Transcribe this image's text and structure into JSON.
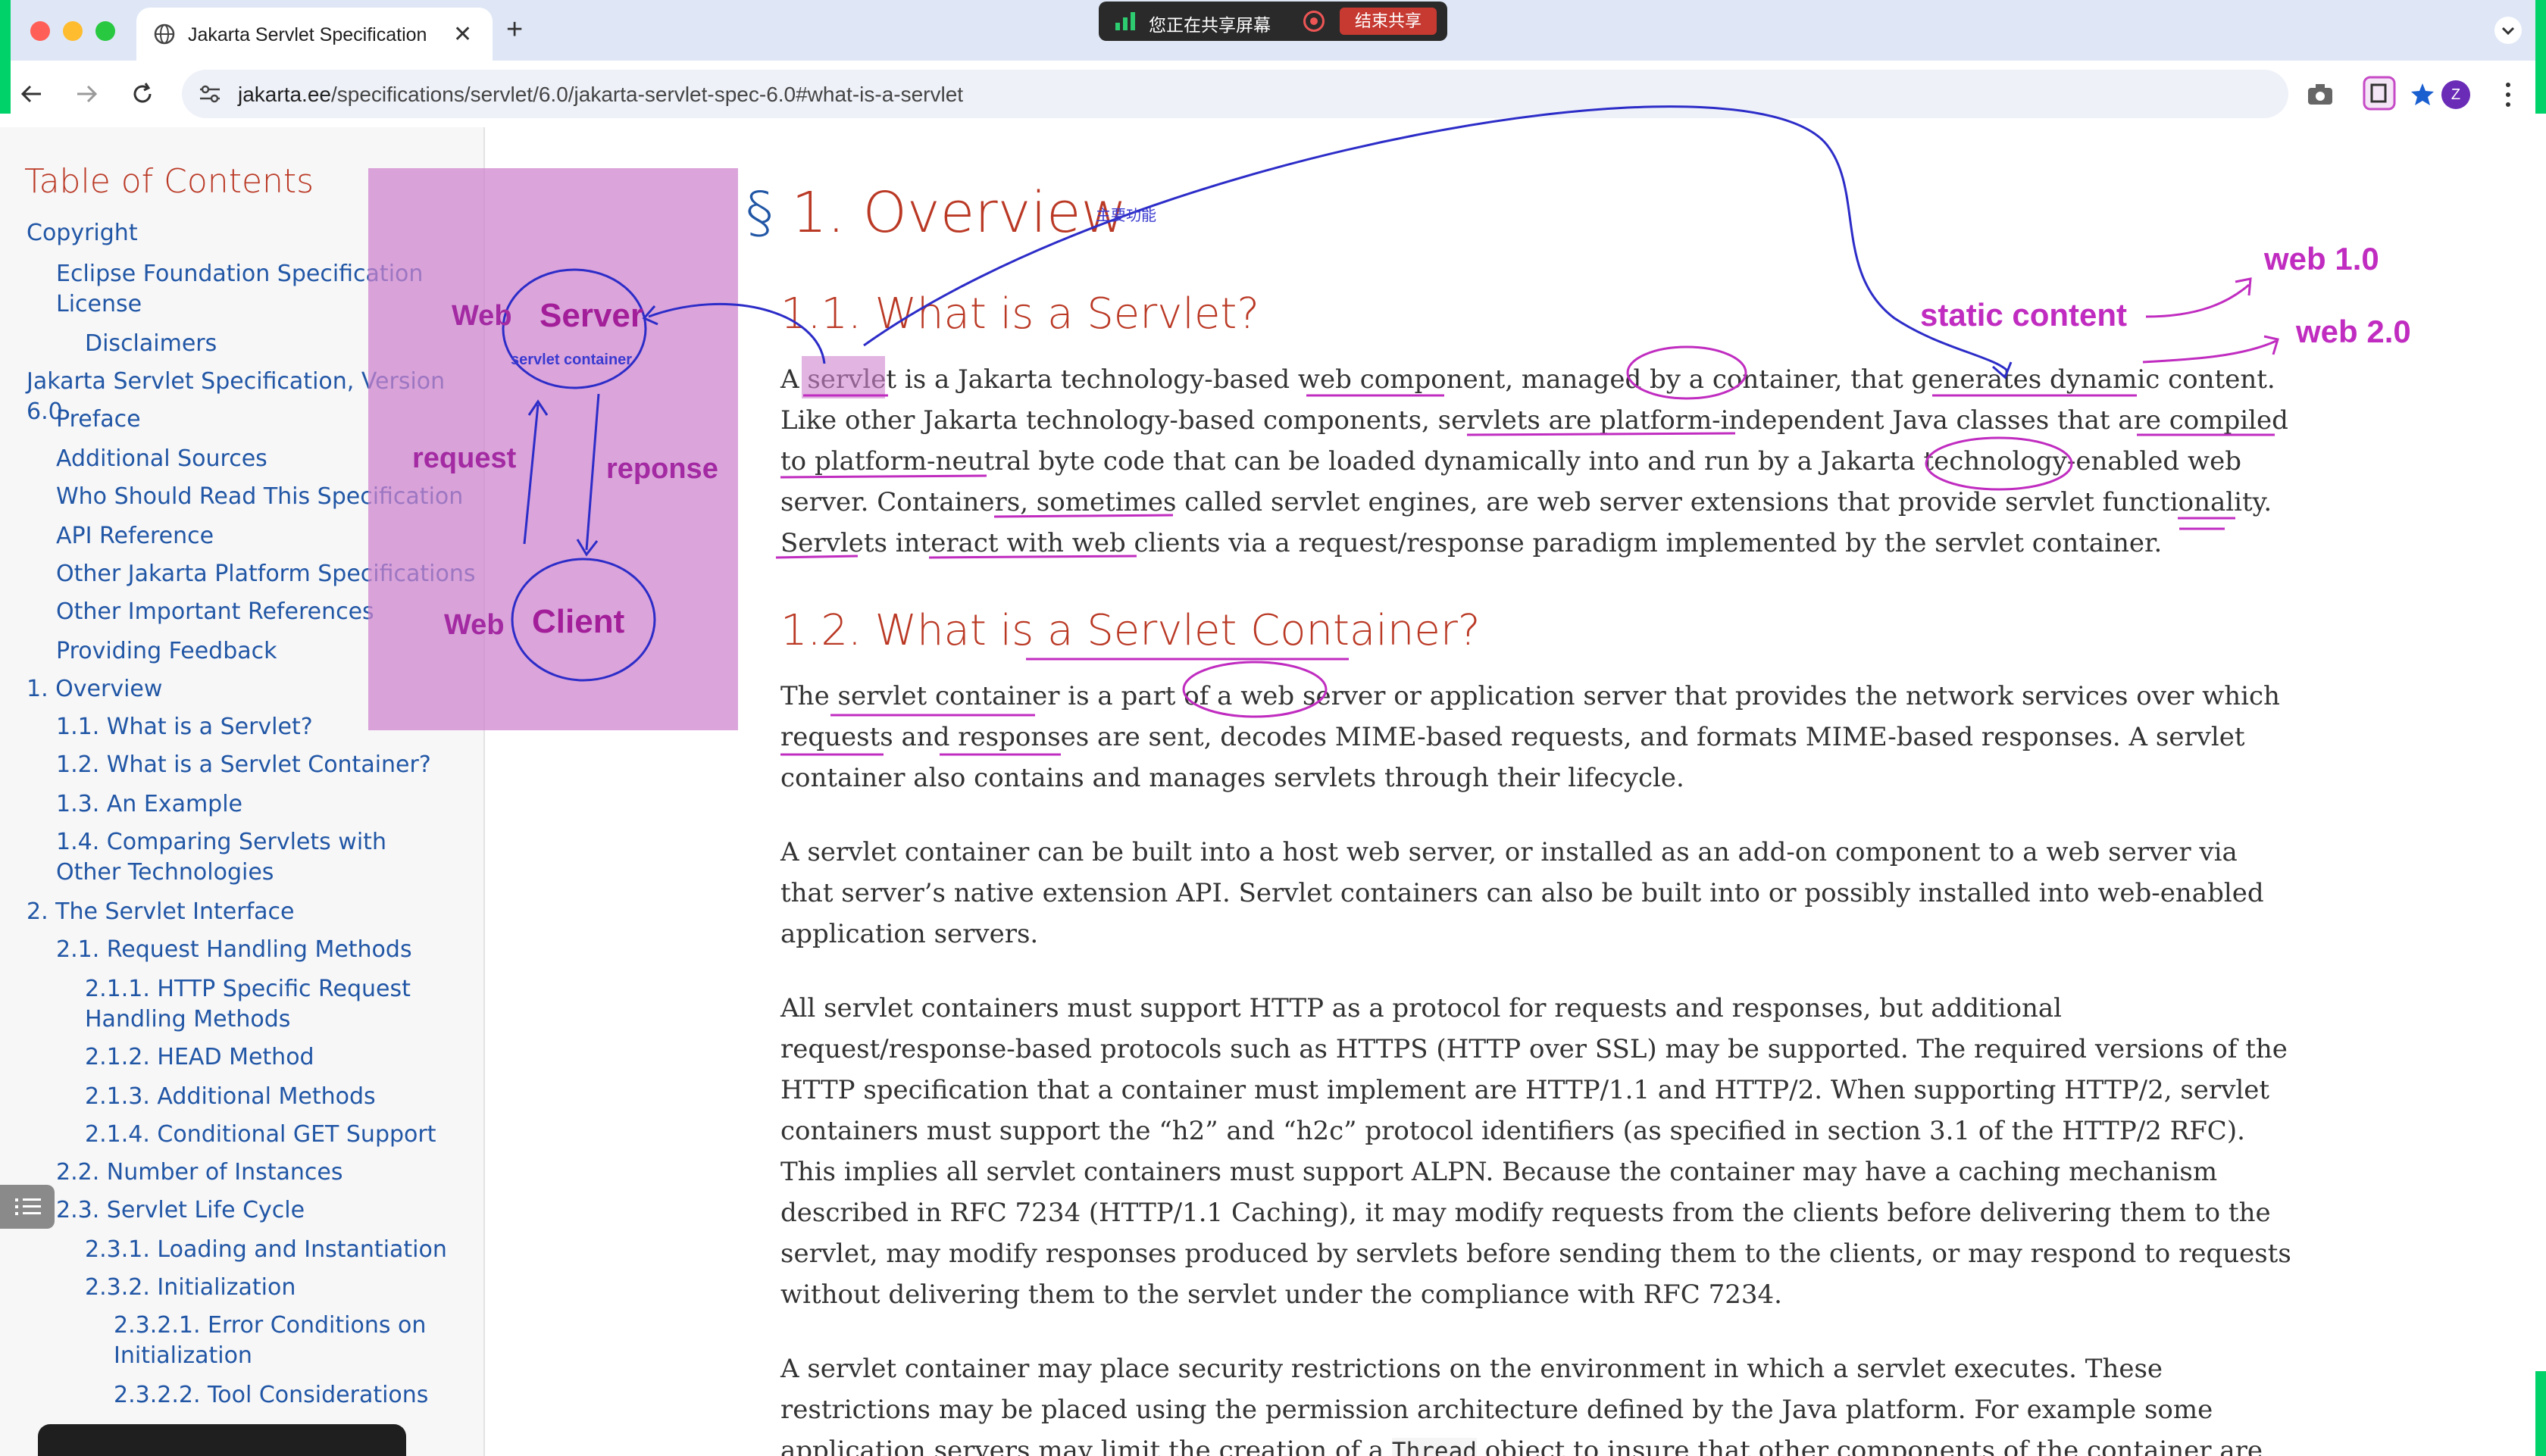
{
  "browser": {
    "tab_title": "Jakarta Servlet Specification",
    "url_host": "jakarta.ee",
    "url_path": "/specifications/servlet/6.0/jakarta-servlet-spec-6.0#what-is-a-servlet",
    "avatar_letter": "Z",
    "share_text": "您正在共享屏幕",
    "share_stop": "结束共享"
  },
  "toc": {
    "title": "Table of Contents",
    "items": [
      "Copyright",
      "Eclipse Foundation Specification License",
      "Disclaimers",
      "Jakarta Servlet Specification, Version 6.0",
      "Preface",
      "Additional Sources",
      "Who Should Read This Specification",
      "API Reference",
      "Other Jakarta Platform Specifications",
      "Other Important References",
      "Providing Feedback",
      "1. Overview",
      "1.1. What is a Servlet?",
      "1.2. What is a Servlet Container?",
      "1.3. An Example",
      "1.4. Comparing Servlets with Other Technologies",
      "2. The Servlet Interface",
      "2.1. Request Handling Methods",
      "2.1.1. HTTP Specific Request Handling Methods",
      "2.1.2. HEAD Method",
      "2.1.3. Additional Methods",
      "2.1.4. Conditional GET Support",
      "2.2. Number of Instances",
      "2.3. Servlet Life Cycle",
      "2.3.1. Loading and Instantiation",
      "2.3.2. Initialization",
      "2.3.2.1. Error Conditions on Initialization",
      "2.3.2.2. Tool Considerations"
    ]
  },
  "content": {
    "h1_anchor": "§",
    "h1": "1. Overview",
    "s1_title": "1.1. What is a Servlet?",
    "s1_p1": "A servlet is a Jakarta technology-based web component, managed by a container, that generates dynamic content. Like other Jakarta technology-based components, servlets are platform-independent Java classes that are compiled to platform-neutral byte code that can be loaded dynamically into and run by a Jakarta technology-enabled web server. Containers, sometimes called servlet engines, are web server extensions that provide servlet functionality. Servlets interact with web clients via a request/response paradigm implemented by the servlet container.",
    "s2_title": "1.2. What is a Servlet Container?",
    "s2_p1": "The servlet container is a part of a web server or application server that provides the network services over which requests and responses are sent, decodes MIME-based requests, and formats MIME-based responses. A servlet container also contains and manages servlets through their lifecycle.",
    "s2_p2": "A servlet container can be built into a host web server, or installed as an add-on component to a web server via that server’s native extension API. Servlet containers can also be built into or possibly installed into web-enabled application servers.",
    "s2_p3": "All servlet containers must support HTTP as a protocol for requests and responses, but additional request/response-based protocols such as HTTPS (HTTP over SSL) may be supported. The required versions of the HTTP specification that a container must implement are HTTP/1.1 and HTTP/2. When supporting HTTP/2, servlet containers must support the “h2” and “h2c” protocol identifiers (as specified in section 3.1 of the HTTP/2 RFC). This implies all servlet containers must support ALPN. Because the container may have a caching mechanism described in RFC 7234 (HTTP/1.1 Caching), it may modify requests from the clients before delivering them to the servlet, may modify responses produced by servlets before sending them to the clients, or may respond to requests without delivering them to the servlet under the compliance with RFC 7234.",
    "s2_p4_a": "A servlet container may place security restrictions on the environment in which a servlet executes. These restrictions may be placed using the permission architecture defined by the Java platform. For example some application servers may limit the creation of a ",
    "s2_p4_code": "Thread",
    "s2_p4_b": " object to insure that other components of the container are not negatively impacted."
  },
  "annotations": {
    "server": "Server",
    "servlet_container": "servlet container",
    "web_top": "Web",
    "web_bottom": "Web",
    "client": "Client",
    "request": "request",
    "reponse": "reponse",
    "static_content": "static content",
    "web1": "web 1.0",
    "web2": "web 2.0",
    "main_func": "主要功能"
  },
  "colors": {
    "heading": "#ba3925",
    "link": "#2156a5",
    "annotation_magenta": "#a32aa2",
    "annotation_blue": "#3a3ad0"
  }
}
